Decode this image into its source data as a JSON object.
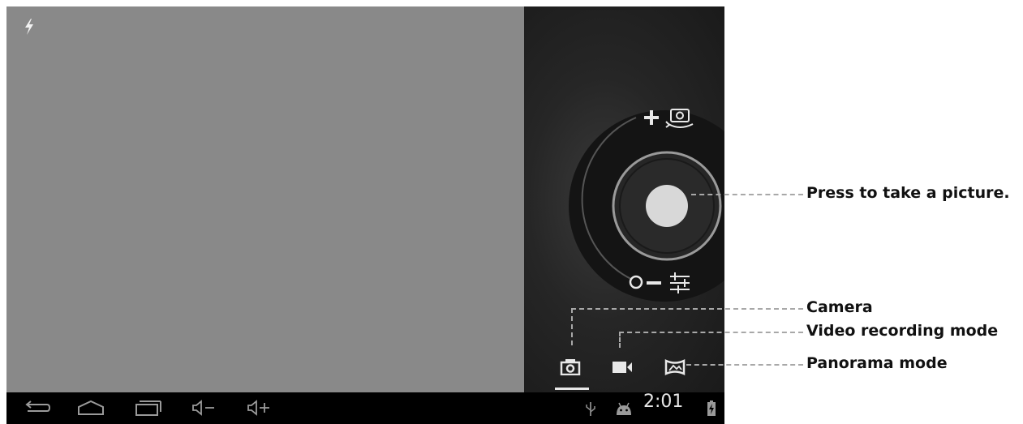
{
  "camera": {
    "flash_icon": "flash-icon",
    "shutter_icon": "shutter-icon",
    "zoom_in_icon": "plus-icon",
    "zoom_out_icon": "minus-icon",
    "switch_camera_icon": "switch-camera-icon",
    "settings_icon": "sliders-icon",
    "modes": [
      {
        "icon": "camera-icon",
        "selected": true
      },
      {
        "icon": "video-camera-icon",
        "selected": false
      },
      {
        "icon": "panorama-icon",
        "selected": false
      }
    ]
  },
  "navbar": {
    "back_icon": "back-icon",
    "home_icon": "home-icon",
    "recents_icon": "recent-apps-icon",
    "volume_down_icon": "volume-down-icon",
    "volume_up_icon": "volume-up-icon",
    "usb_icon": "usb-icon",
    "android_icon": "android-debug-icon",
    "time": "2:01",
    "battery_icon": "battery-charging-icon"
  },
  "callouts": {
    "shutter": "Press to take a picture.",
    "camera": "Camera",
    "video": "Video recording mode",
    "panorama": "Panorama mode"
  },
  "colors": {
    "viewfinder": "#898989",
    "panel_dark": "#222222",
    "dial": "#141414",
    "shutter": "#d8d8d8",
    "callout_line": "#a8a8a8"
  }
}
